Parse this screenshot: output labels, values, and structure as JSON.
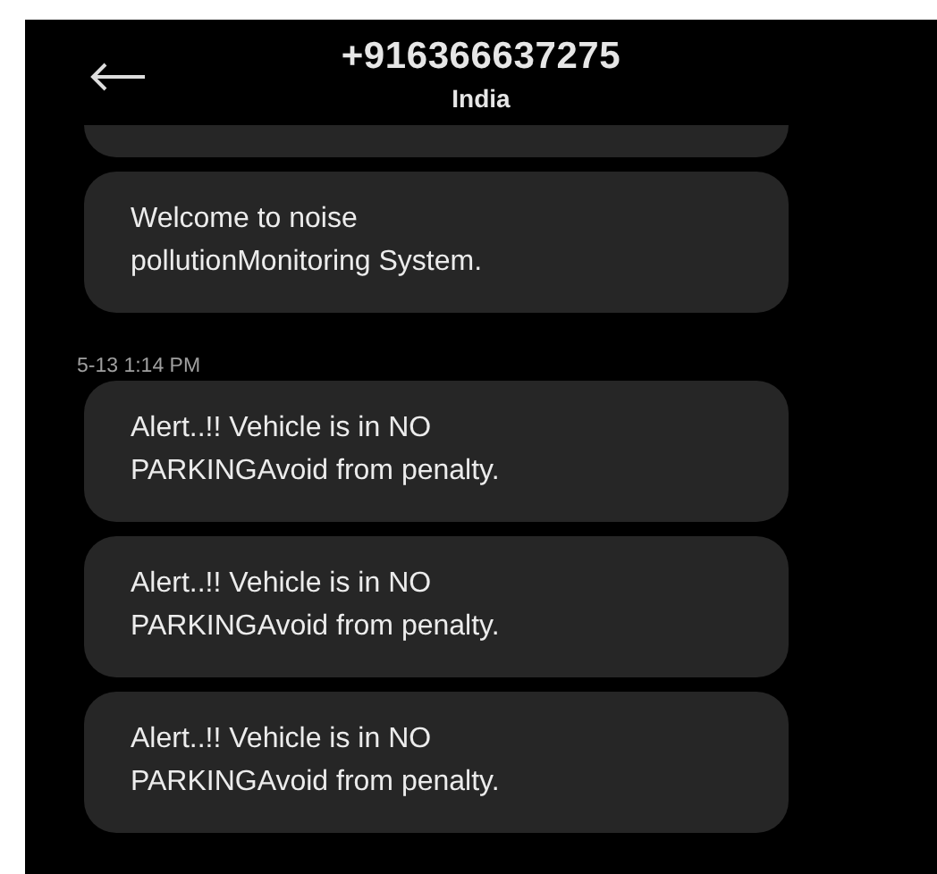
{
  "header": {
    "title": "+916366637275",
    "subtitle": "India"
  },
  "messages": [
    {
      "kind": "message",
      "text": "Welcome to noise pollutionMonitoring System."
    },
    {
      "kind": "timestamp",
      "text": "5-13 1:14 PM"
    },
    {
      "kind": "message",
      "text": "Alert..!! Vehicle is in NO PARKINGAvoid from penalty."
    },
    {
      "kind": "message",
      "text": "Alert..!! Vehicle is in NO PARKINGAvoid from penalty."
    },
    {
      "kind": "message",
      "text": "Alert..!! Vehicle is in NO PARKINGAvoid from penalty."
    }
  ]
}
